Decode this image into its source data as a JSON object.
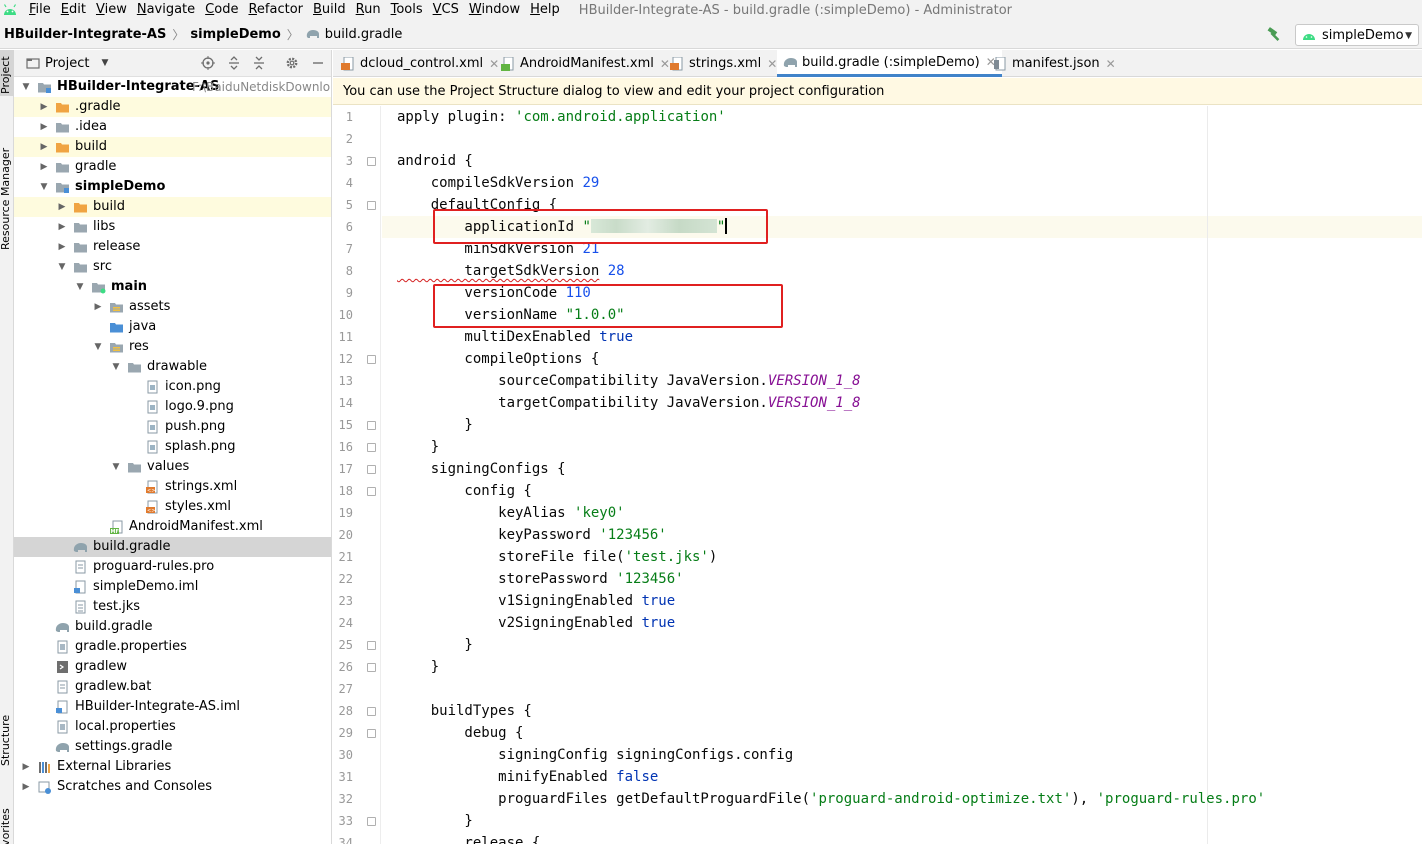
{
  "menu": {
    "items": [
      "File",
      "Edit",
      "View",
      "Navigate",
      "Code",
      "Refactor",
      "Build",
      "Run",
      "Tools",
      "VCS",
      "Window",
      "Help"
    ],
    "window_title": "HBuilder-Integrate-AS - build.gradle (:simpleDemo) - Administrator"
  },
  "breadcrumb": {
    "project": "HBuilder-Integrate-AS",
    "module": "simpleDemo",
    "file": "build.gradle"
  },
  "run_config": {
    "label": "simpleDemo"
  },
  "toolstrip": {
    "project": "Project",
    "resource_manager": "Resource Manager",
    "structure": "Structure",
    "favorites": "Favorites"
  },
  "project_panel": {
    "title": "Project",
    "tree": [
      {
        "label": "HBuilder-Integrate-AS",
        "hint": "F:\\BaiduNetdiskDownlo",
        "bold": true
      },
      {
        "label": ".gradle"
      },
      {
        "label": ".idea"
      },
      {
        "label": "build"
      },
      {
        "label": "gradle"
      },
      {
        "label": "simpleDemo",
        "bold": true
      },
      {
        "label": "build"
      },
      {
        "label": "libs"
      },
      {
        "label": "release"
      },
      {
        "label": "src"
      },
      {
        "label": "main",
        "bold": true
      },
      {
        "label": "assets"
      },
      {
        "label": "java"
      },
      {
        "label": "res"
      },
      {
        "label": "drawable"
      },
      {
        "label": "icon.png"
      },
      {
        "label": "logo.9.png"
      },
      {
        "label": "push.png"
      },
      {
        "label": "splash.png"
      },
      {
        "label": "values"
      },
      {
        "label": "strings.xml"
      },
      {
        "label": "styles.xml"
      },
      {
        "label": "AndroidManifest.xml"
      },
      {
        "label": "build.gradle"
      },
      {
        "label": "proguard-rules.pro"
      },
      {
        "label": "simpleDemo.iml"
      },
      {
        "label": "test.jks"
      },
      {
        "label": "build.gradle"
      },
      {
        "label": "gradle.properties"
      },
      {
        "label": "gradlew"
      },
      {
        "label": "gradlew.bat"
      },
      {
        "label": "HBuilder-Integrate-AS.iml"
      },
      {
        "label": "local.properties"
      },
      {
        "label": "settings.gradle"
      },
      {
        "label": "External Libraries"
      },
      {
        "label": "Scratches and Consoles"
      }
    ]
  },
  "tabs": [
    {
      "label": "dcloud_control.xml"
    },
    {
      "label": "AndroidManifest.xml"
    },
    {
      "label": "strings.xml"
    },
    {
      "label": "build.gradle (:simpleDemo)"
    },
    {
      "label": "manifest.json"
    }
  ],
  "tab_icon_badges": {
    "manifest": "MF"
  },
  "banner": "You can use the Project Structure dialog to view and edit your project configuration",
  "editor": {
    "line_numbers": [
      "1",
      "2",
      "3",
      "4",
      "5",
      "6",
      "7",
      "8",
      "9",
      "10",
      "11",
      "12",
      "13",
      "14",
      "15",
      "16",
      "17",
      "18",
      "19",
      "20",
      "21",
      "22",
      "23",
      "24",
      "25",
      "26",
      "27",
      "28",
      "29",
      "30",
      "31",
      "32",
      "33",
      "34"
    ],
    "code": {
      "l1_a": "apply plugin: ",
      "l1_b": "'com.android.application'",
      "l3": "android {",
      "l4_a": "    compileSdkVersion ",
      "l4_b": "29",
      "l5": "    defaultConfig {",
      "l6_a": "        applicationId ",
      "l6_b": "\"",
      "l6_c": "\"",
      "l7_a": "        minSdkVersion ",
      "l7_b": "21",
      "l8_a": "        targetSdkVersion",
      "l8_b": " 28",
      "l9_a": "        versionCode ",
      "l9_b": "110",
      "l10_a": "        versionName ",
      "l10_b": "\"1.0.0\"",
      "l11_a": "        multiDexEnabled ",
      "l11_b": "true",
      "l12": "        compileOptions {",
      "l13_a": "            sourceCompatibility JavaVersion.",
      "l13_b": "VERSION_1_8",
      "l14_a": "            targetCompatibility JavaVersion.",
      "l14_b": "VERSION_1_8",
      "l15": "        }",
      "l16": "    }",
      "l17": "    signingConfigs {",
      "l18": "        config {",
      "l19_a": "            keyAlias ",
      "l19_b": "'key0'",
      "l20_a": "            keyPassword ",
      "l20_b": "'123456'",
      "l21_a": "            storeFile file(",
      "l21_b": "'test.jks'",
      "l21_c": ")",
      "l22_a": "            storePassword ",
      "l22_b": "'123456'",
      "l23_a": "            v1SigningEnabled ",
      "l23_b": "true",
      "l24_a": "            v2SigningEnabled ",
      "l24_b": "true",
      "l25": "        }",
      "l26": "    }",
      "l28": "    buildTypes {",
      "l29": "        debug {",
      "l30": "            signingConfig signingConfigs.config",
      "l31_a": "            minifyEnabled ",
      "l31_b": "false",
      "l32_a": "            proguardFiles getDefaultProguardFile(",
      "l32_b": "'proguard-android-optimize.txt'",
      "l32_c": "), ",
      "l32_d": "'proguard-rules.pro'",
      "l33": "        }",
      "l34": "        release {"
    }
  },
  "colors": {
    "string": "#067d17",
    "number": "#1750eb",
    "keyword": "#0033b3",
    "constant": "#871094",
    "annotation_box": "#e02020",
    "active_tab": "#4083c9"
  }
}
